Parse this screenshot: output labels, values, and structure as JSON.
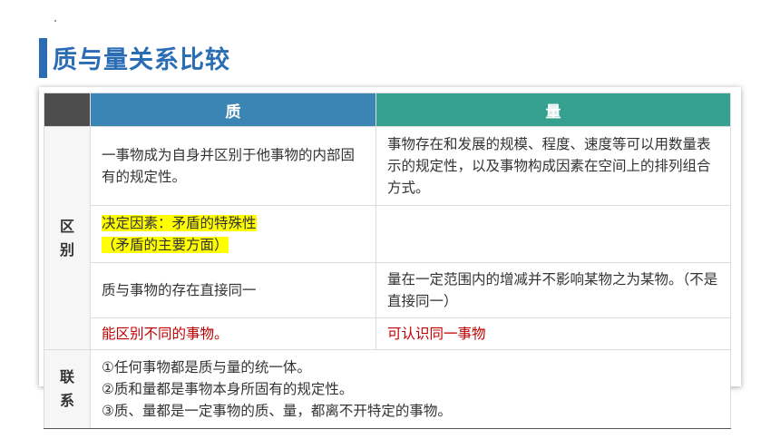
{
  "title": "质与量关系比较",
  "table": {
    "headers": {
      "quality": "质",
      "quantity": "量"
    },
    "side_labels": {
      "difference": [
        "区",
        "别"
      ],
      "connection": [
        "联",
        "系"
      ]
    },
    "rows": [
      {
        "quality": "一事物成为自身并区别于他事物的内部固有的规定性。",
        "quantity": "事物存在和发展的规模、程度、速度等可以用数量表示的规定性，以及事物构成因素在空间上的排列组合方式。"
      },
      {
        "quality_lines": [
          "决定因素：矛盾的特殊性",
          "（矛盾的主要方面）"
        ],
        "quantity": ""
      },
      {
        "quality": "质与事物的存在直接同一",
        "quantity": "量在一定范围内的增减并不影响某物之为某物。（不是直接同一）"
      },
      {
        "quality": "能区别不同的事物。",
        "quantity": "可认识同一事物"
      }
    ],
    "connection_lines": [
      "①任何事物都是质与量的统一体。",
      "②质和量都是事物本身所固有的规定性。",
      "③质、量都是一定事物的质、量，都离不开特定的事物。"
    ]
  },
  "colors": {
    "title": "#2a6db5",
    "header_quality": "#3a85b4",
    "header_quantity": "#36a18e",
    "corner": "#4d4d4d",
    "highlight": "#ffff00",
    "red_text": "#c00000"
  }
}
